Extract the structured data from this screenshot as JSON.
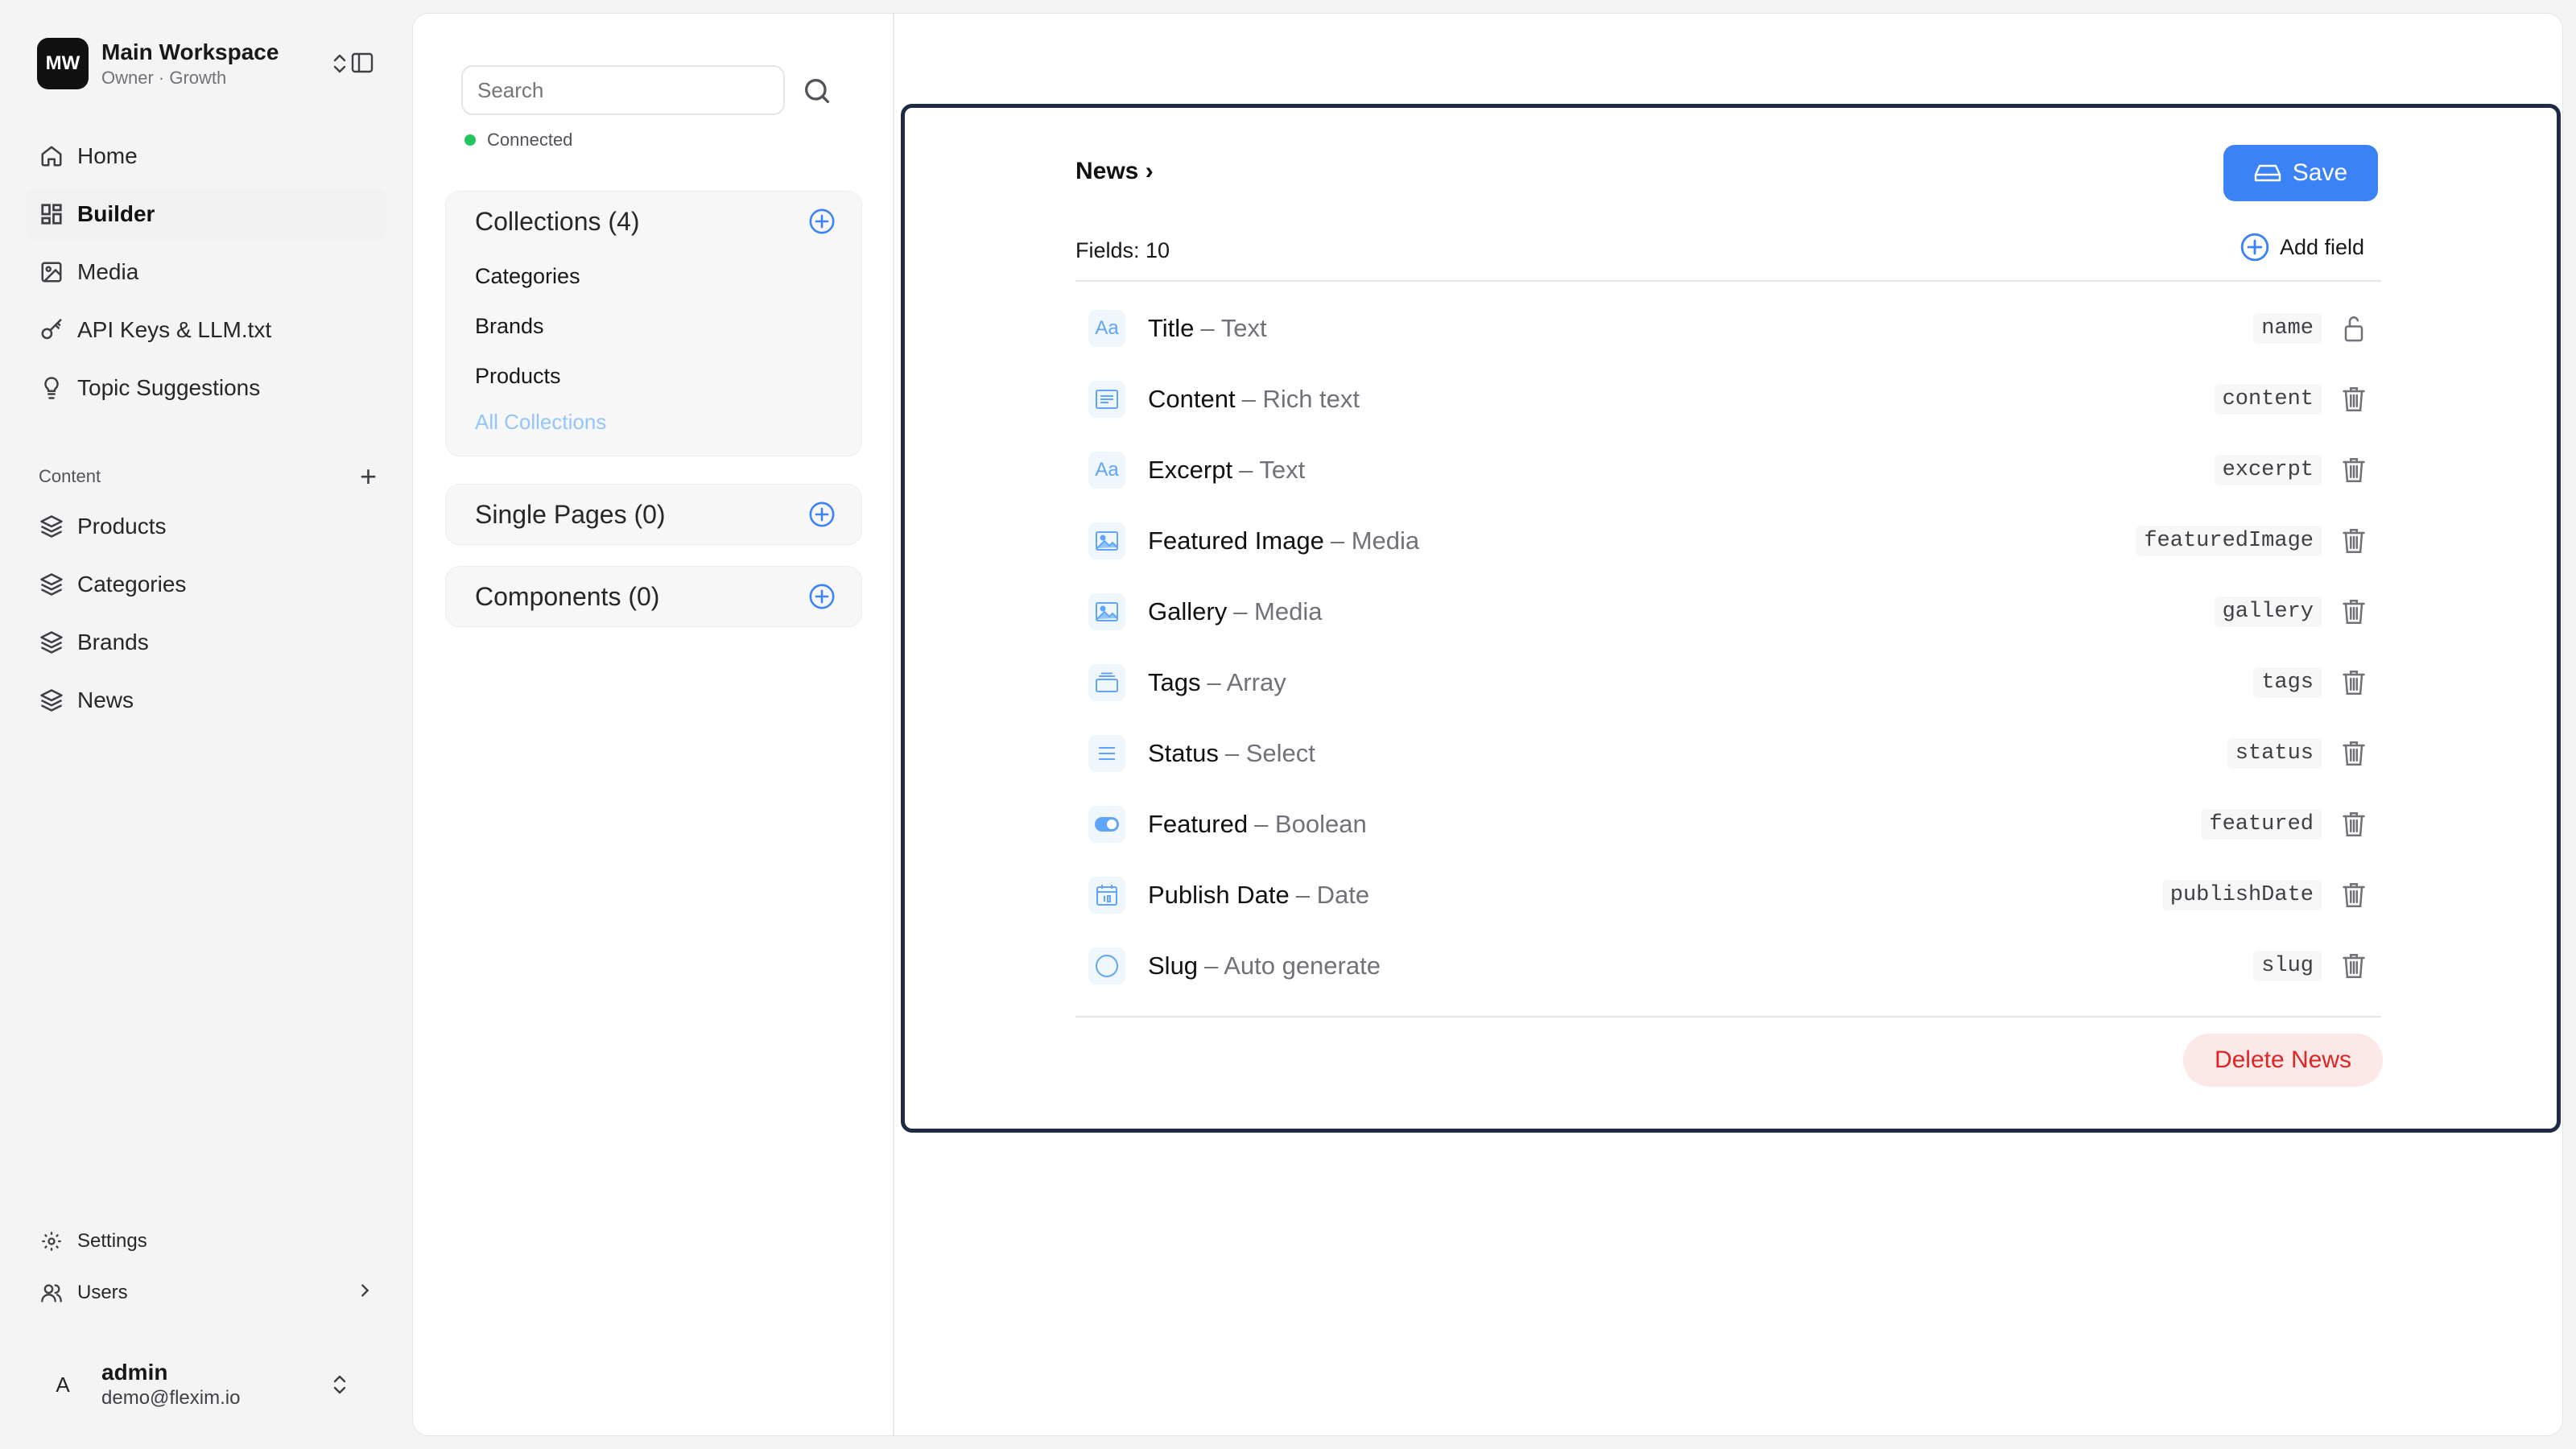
{
  "workspace": {
    "initials": "MW",
    "name": "Main Workspace",
    "subtitle": "Owner · Growth"
  },
  "nav": [
    {
      "label": "Home",
      "icon": "home-icon"
    },
    {
      "label": "Builder",
      "icon": "grid-icon",
      "active": true
    },
    {
      "label": "Media",
      "icon": "image-icon"
    },
    {
      "label": "API Keys & LLM.txt",
      "icon": "key-icon"
    },
    {
      "label": "Topic Suggestions",
      "icon": "lightbulb-icon"
    }
  ],
  "content_section": {
    "title": "Content",
    "items": [
      "Products",
      "Categories",
      "Brands",
      "News"
    ]
  },
  "bottom_nav": {
    "settings": "Settings",
    "users": "Users"
  },
  "user": {
    "initial": "A",
    "name": "admin",
    "email": "demo@flexim.io"
  },
  "search": {
    "placeholder": "Search"
  },
  "connection": {
    "status": "Connected",
    "color": "#22c55e"
  },
  "collections": {
    "title": "Collections (4)",
    "items": [
      "Categories",
      "Brands",
      "Products"
    ],
    "all_link": "All Collections"
  },
  "single_pages": {
    "title": "Single Pages (0)"
  },
  "components": {
    "title": "Components (0)"
  },
  "editor": {
    "breadcrumb": "News ›",
    "save_label": "Save",
    "fields_count": "Fields: 10",
    "add_field_label": "Add field",
    "delete_label": "Delete News",
    "fields": [
      {
        "name": "Title",
        "type": "– Text",
        "key": "name",
        "icon": "text-icon",
        "action": "lock-icon"
      },
      {
        "name": "Content",
        "type": "– Rich text",
        "key": "content",
        "icon": "richtext-icon",
        "action": "trash-icon"
      },
      {
        "name": "Excerpt",
        "type": "– Text",
        "key": "excerpt",
        "icon": "text-icon",
        "action": "trash-icon"
      },
      {
        "name": "Featured Image",
        "type": "– Media",
        "key": "featuredImage",
        "icon": "media-icon",
        "action": "trash-icon"
      },
      {
        "name": "Gallery",
        "type": "– Media",
        "key": "gallery",
        "icon": "media-icon",
        "action": "trash-icon"
      },
      {
        "name": "Tags",
        "type": "– Array",
        "key": "tags",
        "icon": "array-icon",
        "action": "trash-icon"
      },
      {
        "name": "Status",
        "type": "– Select",
        "key": "status",
        "icon": "select-icon",
        "action": "trash-icon"
      },
      {
        "name": "Featured",
        "type": "– Boolean",
        "key": "featured",
        "icon": "boolean-icon",
        "action": "trash-icon"
      },
      {
        "name": "Publish Date",
        "type": "– Date",
        "key": "publishDate",
        "icon": "date-icon",
        "action": "trash-icon"
      },
      {
        "name": "Slug",
        "type": "– Auto generate",
        "key": "slug",
        "icon": "auto-icon",
        "action": "trash-icon"
      }
    ]
  },
  "colors": {
    "accent": "#3b82f6",
    "danger": "#dc2626",
    "danger_bg": "#fde8e8",
    "editor_border": "#1f2a44"
  }
}
